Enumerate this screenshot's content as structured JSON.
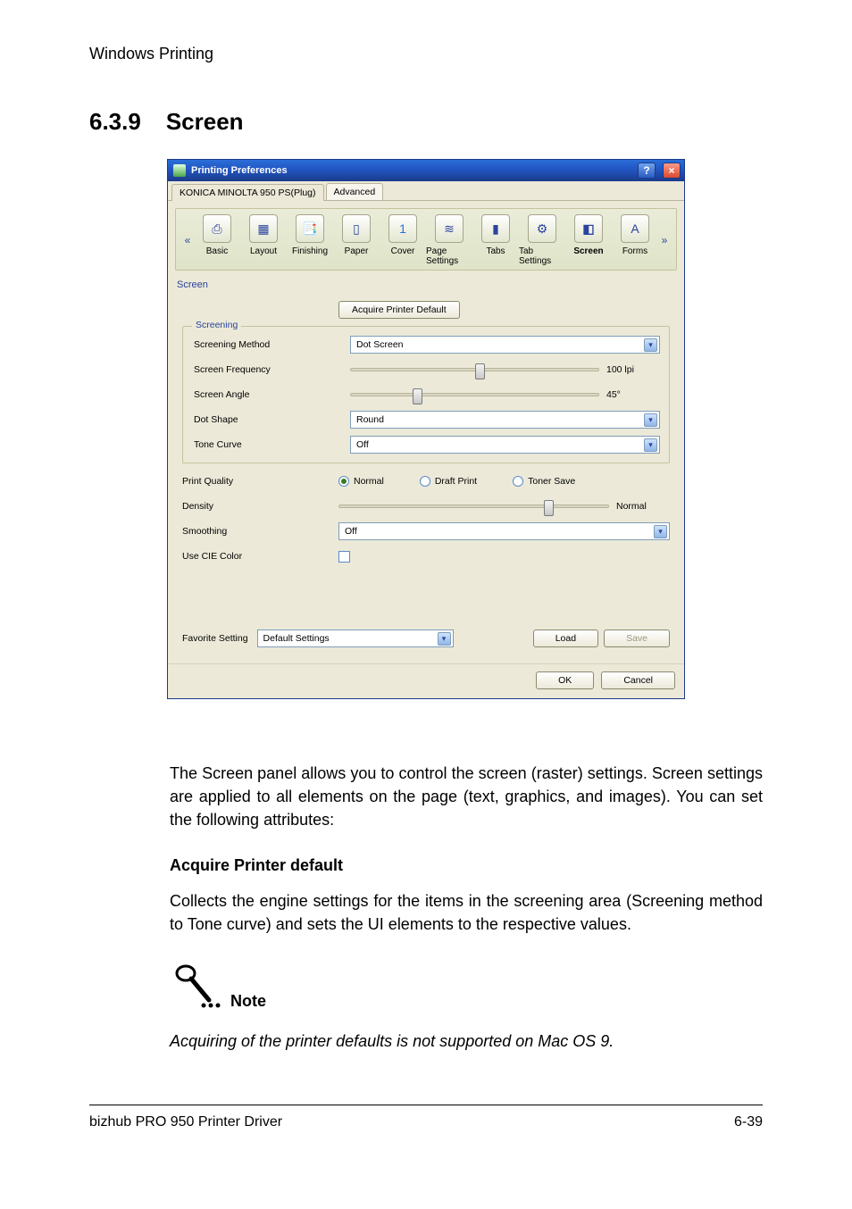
{
  "running_header": "Windows Printing",
  "heading_number": "6.3.9",
  "heading_title": "Screen",
  "dialog": {
    "title": "Printing Preferences",
    "help_icon": "?",
    "close_icon": "×",
    "subtabs": [
      "KONICA MINOLTA 950 PS(Plug)",
      "Advanced"
    ],
    "active_subtab_index": 0,
    "chevron_left": "«",
    "chevron_right": "»",
    "icon_tabs": [
      "Basic",
      "Layout",
      "Finishing",
      "Paper",
      "Cover",
      "Page Settings",
      "Tabs",
      "Tab Settings",
      "Screen",
      "Forms"
    ],
    "selected_icon_tab": "Screen",
    "panel_name": "Screen",
    "acquire_button": "Acquire Printer Default",
    "screening_group": "Screening",
    "screening_method_label": "Screening Method",
    "screening_method_value": "Dot Screen",
    "screen_frequency_label": "Screen Frequency",
    "screen_frequency_value": "100 lpi",
    "screen_frequency_slider_pct": 50,
    "screen_angle_label": "Screen Angle",
    "screen_angle_value": "45°",
    "screen_angle_slider_pct": 25,
    "dot_shape_label": "Dot Shape",
    "dot_shape_value": "Round",
    "tone_curve_label": "Tone Curve",
    "tone_curve_value": "Off",
    "print_quality_label": "Print Quality",
    "pq_normal": "Normal",
    "pq_draft": "Draft Print",
    "pq_toner": "Toner Save",
    "pq_selected": "Normal",
    "density_label": "Density",
    "density_value": "Normal",
    "density_slider_pct": 76,
    "smoothing_label": "Smoothing",
    "smoothing_value": "Off",
    "cie_label": "Use CIE Color",
    "cie_checked": false,
    "favorite_label": "Favorite Setting",
    "favorite_value": "Default Settings",
    "load_btn": "Load",
    "save_btn": "Save",
    "ok_btn": "OK",
    "cancel_btn": "Cancel"
  },
  "paragraph1": "The Screen panel allows you to control the screen (raster) settings. Screen settings are applied to all elements on the page (text, graphics, and images). You can set the following attributes:",
  "subheading1": "Acquire Printer default",
  "paragraph2": "Collects the engine settings for the items in the screening area (Screening method to Tone curve) and sets the UI elements to the respective values.",
  "note_label": "Note",
  "note_text": "Acquiring of the printer defaults is not supported on Mac OS 9.",
  "footer_left": "bizhub PRO 950 Printer Driver",
  "footer_right": "6-39"
}
